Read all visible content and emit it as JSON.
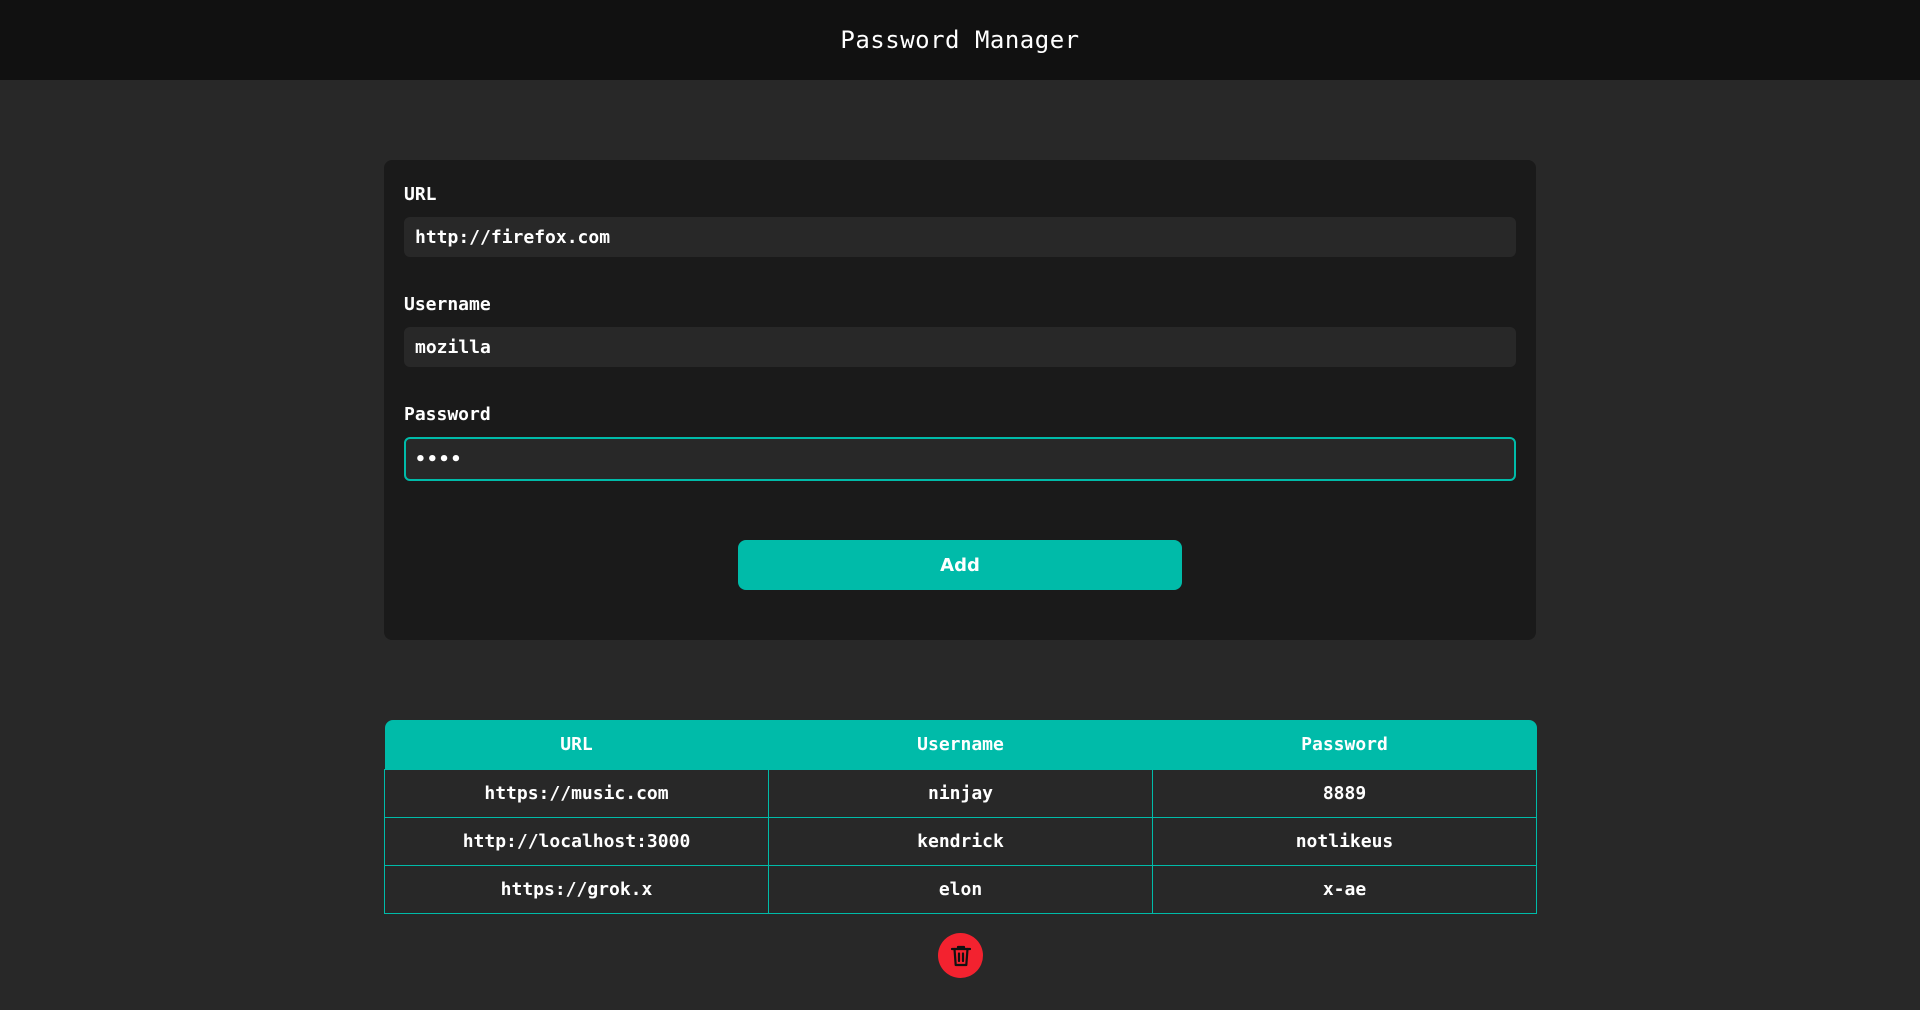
{
  "header": {
    "title": "Password Manager"
  },
  "form": {
    "fields": [
      {
        "label": "URL",
        "value": "http://firefox.com"
      },
      {
        "label": "Username",
        "value": "mozilla"
      },
      {
        "label": "Password",
        "value": "••••"
      }
    ],
    "add_label": "Add"
  },
  "table": {
    "columns": [
      "URL",
      "Username",
      "Password"
    ],
    "rows": [
      [
        "https://music.com",
        "ninjay",
        "8889"
      ],
      [
        "http://localhost:3000",
        "kendrick",
        "notlikeus"
      ],
      [
        "https://grok.x",
        "elon",
        "x-ae"
      ]
    ]
  },
  "delete_icon": "trash-icon",
  "colors": {
    "accent": "#00bba9",
    "danger": "#f3222f",
    "background": "#282828",
    "card": "#1a1a1a",
    "header": "#111111"
  }
}
